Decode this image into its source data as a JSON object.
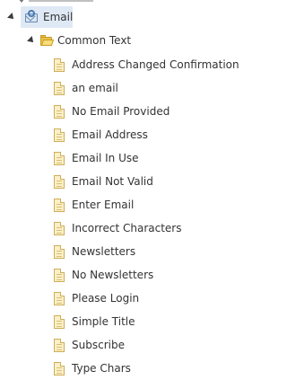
{
  "tree": {
    "root": {
      "label": "Email",
      "icon": "email-template-icon",
      "expanded": true,
      "selected": true
    },
    "folder": {
      "label": "Common Text",
      "icon": "folder-icon",
      "expanded": true
    },
    "items": [
      {
        "label": "Address Changed Confirmation",
        "icon": "document-icon"
      },
      {
        "label": "an email",
        "icon": "document-icon"
      },
      {
        "label": "No Email Provided",
        "icon": "document-icon"
      },
      {
        "label": "Email Address",
        "icon": "document-icon"
      },
      {
        "label": "Email In Use",
        "icon": "document-icon"
      },
      {
        "label": "Email Not Valid",
        "icon": "document-icon"
      },
      {
        "label": "Enter Email",
        "icon": "document-icon"
      },
      {
        "label": "Incorrect Characters",
        "icon": "document-icon"
      },
      {
        "label": "Newsletters",
        "icon": "document-icon"
      },
      {
        "label": "No Newsletters",
        "icon": "document-icon"
      },
      {
        "label": "Please Login",
        "icon": "document-icon"
      },
      {
        "label": "Simple Title",
        "icon": "document-icon"
      },
      {
        "label": "Subscribe",
        "icon": "document-icon"
      },
      {
        "label": "Type Chars",
        "icon": "document-icon"
      }
    ]
  },
  "colors": {
    "selection_bg": "#dfe9f5",
    "text": "#333333",
    "folder": "#e9c34a",
    "document": "#fbf0c8"
  }
}
